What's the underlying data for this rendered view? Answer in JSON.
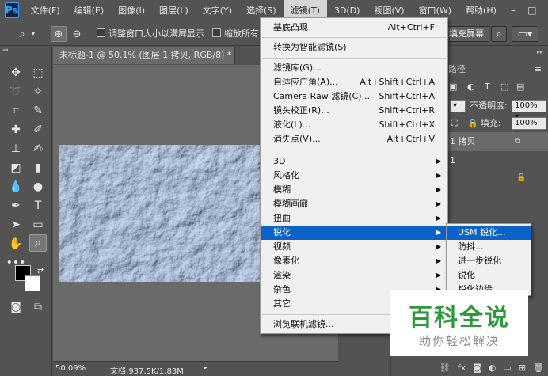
{
  "app": {
    "logo": "Ps"
  },
  "menubar": {
    "items": [
      "文件(F)",
      "编辑(E)",
      "图像(I)",
      "图层(L)",
      "文字(Y)",
      "选择(S)",
      "滤镜(T)",
      "3D(D)",
      "视图(V)",
      "窗口(W)",
      "帮助(H)"
    ],
    "active": "滤镜(T)",
    "window_controls": [
      "–",
      "□",
      "✕"
    ]
  },
  "options_bar": {
    "zoom_tool_icon": "magnifier-icon",
    "zoom_in_icon": "zoom-in-icon",
    "zoom_out_icon": "zoom-out-icon",
    "resize_windows_label": "调整窗口大小以满屏显示",
    "zoom_all_label": "缩放所有",
    "fill_screen_label": "填充屏幕"
  },
  "document": {
    "tab_title": "未标题-1 @ 50.1% (图层 1 拷贝, RGB/8) *",
    "zoom": "50.09%",
    "doc_size": "文档:937.5K/1.83M"
  },
  "right_panel": {
    "tab_label": "路径",
    "opacity_label": "不透明度:",
    "opacity_value": "100%",
    "fill_label": "填充:",
    "fill_value": "100%",
    "layers": [
      "1 拷贝",
      "1"
    ]
  },
  "filter_menu": {
    "items": [
      {
        "label": "基底凸现",
        "shortcut": "Alt+Ctrl+F"
      },
      {
        "label": "转换为智能滤镜(S)",
        "shortcut": ""
      },
      {
        "label": "滤镜库(G)...",
        "shortcut": ""
      },
      {
        "label": "自适应广角(A)...",
        "shortcut": "Alt+Shift+Ctrl+A"
      },
      {
        "label": "Camera Raw 滤镜(C)...",
        "shortcut": "Shift+Ctrl+A"
      },
      {
        "label": "镜头校正(R)...",
        "shortcut": "Shift+Ctrl+R"
      },
      {
        "label": "液化(L)...",
        "shortcut": "Shift+Ctrl+X"
      },
      {
        "label": "消失点(V)...",
        "shortcut": "Alt+Ctrl+V"
      },
      {
        "label": "3D",
        "shortcut": ""
      },
      {
        "label": "风格化",
        "shortcut": ""
      },
      {
        "label": "模糊",
        "shortcut": ""
      },
      {
        "label": "模糊画廊",
        "shortcut": ""
      },
      {
        "label": "扭曲",
        "shortcut": ""
      },
      {
        "label": "锐化",
        "shortcut": ""
      },
      {
        "label": "视频",
        "shortcut": ""
      },
      {
        "label": "像素化",
        "shortcut": ""
      },
      {
        "label": "渲染",
        "shortcut": ""
      },
      {
        "label": "杂色",
        "shortcut": ""
      },
      {
        "label": "其它",
        "shortcut": ""
      },
      {
        "label": "浏览联机滤镜...",
        "shortcut": ""
      }
    ],
    "highlighted": "锐化"
  },
  "sharpen_submenu": {
    "items": [
      "USM 锐化...",
      "防抖...",
      "进一步锐化",
      "锐化",
      "锐化边缘"
    ],
    "highlighted": "USM 锐化..."
  },
  "watermark": {
    "title": "百科全说",
    "subtitle": "助你轻松解决"
  },
  "colors": {
    "ui_bg": "#535353",
    "menu_bg": "#f0f0f0",
    "highlight": "#0a64c8",
    "watermark_green": "#2a9a3a"
  }
}
